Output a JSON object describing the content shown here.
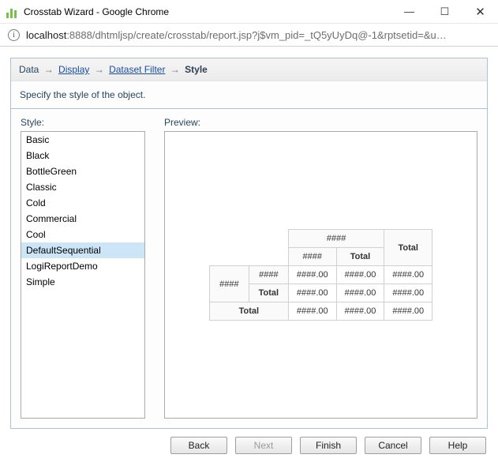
{
  "window": {
    "title": "Crosstab Wizard - Google Chrome"
  },
  "address": {
    "host": "localhost",
    "rest": ":8888/dhtmljsp/create/crosstab/report.jsp?j$vm_pid=_tQ5yUyDq@-1&rptsetid=&u…"
  },
  "breadcrumb": {
    "items": [
      {
        "label": "Data",
        "link": false
      },
      {
        "label": "Display",
        "link": true
      },
      {
        "label": "Dataset Filter",
        "link": true
      },
      {
        "label": "Style",
        "link": false,
        "current": true
      }
    ],
    "arrow": "→"
  },
  "description": "Specify the style of the object.",
  "styleList": {
    "label": "Style:",
    "items": [
      "Basic",
      "Black",
      "BottleGreen",
      "Classic",
      "Cold",
      "Commercial",
      "Cool",
      "DefaultSequential",
      "LogiReportDemo",
      "Simple"
    ],
    "selected": "DefaultSequential"
  },
  "preview": {
    "label": "Preview:",
    "placeholder": "####",
    "valuePlaceholder": "####.00",
    "totalLabel": "Total"
  },
  "buttons": {
    "back": "Back",
    "next": "Next",
    "finish": "Finish",
    "cancel": "Cancel",
    "help": "Help"
  }
}
